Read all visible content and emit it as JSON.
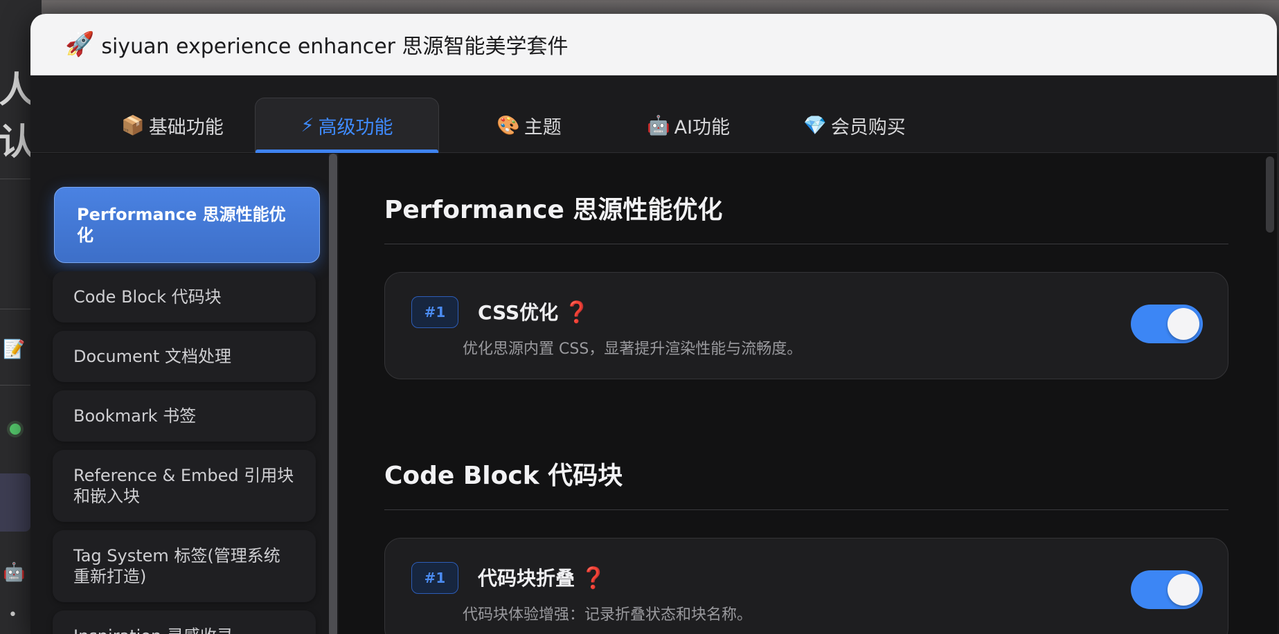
{
  "background_app": {
    "glyph": "人认"
  },
  "window": {
    "title": "siyuan experience enhancer 思源智能美学套件",
    "title_icon": "rocket-icon"
  },
  "tabs": [
    {
      "emoji": "📦",
      "label": "基础功能",
      "active": false
    },
    {
      "emoji": "⚡",
      "label": "高级功能",
      "active": true
    },
    {
      "emoji": "🎨",
      "label": "主题",
      "active": false
    },
    {
      "emoji": "🤖",
      "label": "AI功能",
      "active": false
    },
    {
      "emoji": "💎",
      "label": "会员购买",
      "active": false
    }
  ],
  "sidebar": {
    "items": [
      {
        "label": "Performance 思源性能优化",
        "active": true
      },
      {
        "label": "Code Block 代码块"
      },
      {
        "label": "Document 文档处理"
      },
      {
        "label": "Bookmark 书签"
      },
      {
        "label": "Reference & Embed 引用块和嵌入块"
      },
      {
        "label": "Tag System 标签(管理系统重新打造)"
      },
      {
        "label": "Inspiration 灵感收录"
      }
    ]
  },
  "sections": [
    {
      "title": "Performance 思源性能优化",
      "card": {
        "badge": "#1",
        "title": "CSS优化",
        "help": "❓",
        "desc": "优化思源内置 CSS，显著提升渲染性能与流畅度。",
        "enabled": true
      }
    },
    {
      "title": "Code Block 代码块",
      "card": {
        "badge": "#1",
        "title": "代码块折叠",
        "help": "❓",
        "desc": "代码块体验增强：记录折叠状态和块名称。",
        "enabled": true
      }
    }
  ],
  "colors": {
    "accent": "#3f83f0",
    "toggle_on": "#3c86f5",
    "help": "#c0152f"
  }
}
